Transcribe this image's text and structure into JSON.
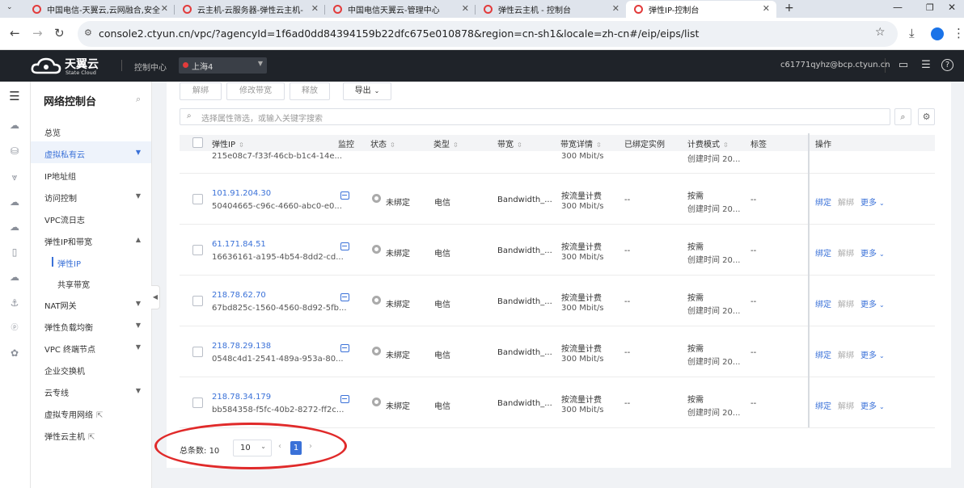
{
  "browser": {
    "tabs": [
      {
        "title": "中国电信-天翼云,云网融合,安全"
      },
      {
        "title": "云主机-云服务器-弹性云主机-"
      },
      {
        "title": "中国电信天翼云-管理中心"
      },
      {
        "title": "弹性云主机 - 控制台"
      },
      {
        "title": "弹性IP-控制台"
      }
    ],
    "url": "console2.ctyun.cn/vpc/?agencyId=1f6ad0dd84394159b22dfc675e010878&region=cn-sh1&locale=zh-cn#/eip/eips/list"
  },
  "header": {
    "brand": "天翼云",
    "brand_sub": "State Cloud",
    "console": "控制中心",
    "region": "上海4",
    "account": "c61771qyhz@bcp.ctyun.cn"
  },
  "sidebar": {
    "title": "网络控制台",
    "items": [
      {
        "label": "总览"
      },
      {
        "label": "虚拟私有云"
      },
      {
        "label": "IP地址组"
      },
      {
        "label": "访问控制"
      },
      {
        "label": "VPC流日志"
      },
      {
        "label": "弹性IP和带宽"
      },
      {
        "label": "弹性IP"
      },
      {
        "label": "共享带宽"
      },
      {
        "label": "NAT网关"
      },
      {
        "label": "弹性负载均衡"
      },
      {
        "label": "VPC 终端节点"
      },
      {
        "label": "企业交换机"
      },
      {
        "label": "云专线"
      },
      {
        "label": "虚拟专用网络"
      },
      {
        "label": "弹性云主机"
      }
    ]
  },
  "toolbar": {
    "unbind": "解绑",
    "modify_bandwidth": "修改带宽",
    "release": "释放",
    "export": "导出"
  },
  "search": {
    "placeholder": "选择属性筛选，或输入关键字搜索"
  },
  "table": {
    "columns": [
      "弹性IP",
      "监控",
      "状态",
      "类型",
      "带宽",
      "带宽详情",
      "已绑定实例",
      "计费模式",
      "标签",
      "操作"
    ],
    "partial_row": {
      "id": "215e08c7-f33f-46cb-b1c4-14e...",
      "bw_detail": "300 Mbit/s",
      "billing_time": "创建时间 20..."
    },
    "rows": [
      {
        "ip": "101.91.204.30",
        "id": "50404665-c96c-4660-abc0-e0...",
        "status": "未绑定",
        "type": "电信",
        "bandwidth": "Bandwidth_...",
        "bw_mode": "按流量计费",
        "bw_detail": "300 Mbit/s",
        "instance": "--",
        "billing": "按需",
        "billing_time": "创建时间 20...",
        "tags": "--"
      },
      {
        "ip": "61.171.84.51",
        "id": "16636161-a195-4b54-8dd2-cd...",
        "status": "未绑定",
        "type": "电信",
        "bandwidth": "Bandwidth_...",
        "bw_mode": "按流量计费",
        "bw_detail": "300 Mbit/s",
        "instance": "--",
        "billing": "按需",
        "billing_time": "创建时间 20...",
        "tags": "--"
      },
      {
        "ip": "218.78.62.70",
        "id": "67bd825c-1560-4560-8d92-5fb...",
        "status": "未绑定",
        "type": "电信",
        "bandwidth": "Bandwidth_...",
        "bw_mode": "按流量计费",
        "bw_detail": "300 Mbit/s",
        "instance": "--",
        "billing": "按需",
        "billing_time": "创建时间 20...",
        "tags": "--"
      },
      {
        "ip": "218.78.29.138",
        "id": "0548c4d1-2541-489a-953a-80...",
        "status": "未绑定",
        "type": "电信",
        "bandwidth": "Bandwidth_...",
        "bw_mode": "按流量计费",
        "bw_detail": "300 Mbit/s",
        "instance": "--",
        "billing": "按需",
        "billing_time": "创建时间 20...",
        "tags": "--"
      },
      {
        "ip": "218.78.34.179",
        "id": "bb584358-f5fc-40b2-8272-ff2c...",
        "status": "未绑定",
        "type": "电信",
        "bandwidth": "Bandwidth_...",
        "bw_mode": "按流量计费",
        "bw_detail": "300 Mbit/s",
        "instance": "--",
        "billing": "按需",
        "billing_time": "创建时间 20...",
        "tags": "--"
      }
    ],
    "actions": {
      "bind": "绑定",
      "unbind": "解绑",
      "more": "更多"
    }
  },
  "pagination": {
    "total_label": "总条数:",
    "total": "10",
    "page_size": "10",
    "current_page": "1"
  },
  "colors": {
    "accent": "#3a71d8",
    "header_bg": "#1f2329",
    "annotation": "#e02a2a"
  }
}
